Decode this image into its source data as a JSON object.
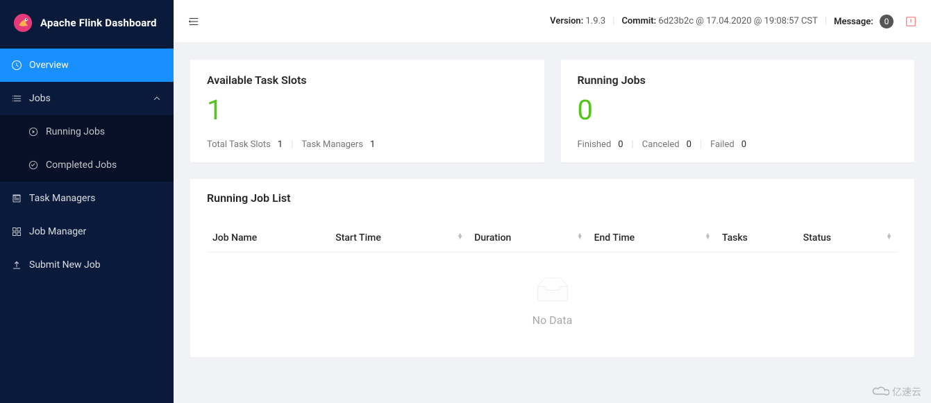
{
  "app": {
    "title": "Apache Flink Dashboard"
  },
  "sidebar": {
    "items": [
      {
        "label": "Overview",
        "icon": "dashboard-icon"
      },
      {
        "label": "Jobs",
        "icon": "jobs-icon",
        "expanded": true,
        "children": [
          {
            "label": "Running Jobs",
            "icon": "play-circle-icon"
          },
          {
            "label": "Completed Jobs",
            "icon": "check-circle-icon"
          }
        ]
      },
      {
        "label": "Task Managers",
        "icon": "schedule-icon"
      },
      {
        "label": "Job Manager",
        "icon": "build-icon"
      },
      {
        "label": "Submit New Job",
        "icon": "upload-icon"
      }
    ]
  },
  "topbar": {
    "version_label": "Version:",
    "version_value": "1.9.3",
    "commit_label": "Commit:",
    "commit_value": "6d23b2c @ 17.04.2020 @ 19:08:57 CST",
    "message_label": "Message:",
    "message_count": "0"
  },
  "cards": {
    "slots": {
      "title": "Available Task Slots",
      "value": "1",
      "total_label": "Total Task Slots",
      "total_value": "1",
      "tm_label": "Task Managers",
      "tm_value": "1"
    },
    "jobs": {
      "title": "Running Jobs",
      "value": "0",
      "finished_label": "Finished",
      "finished_value": "0",
      "canceled_label": "Canceled",
      "canceled_value": "0",
      "failed_label": "Failed",
      "failed_value": "0"
    }
  },
  "joblist": {
    "title": "Running Job List",
    "columns": [
      "Job Name",
      "Start Time",
      "Duration",
      "End Time",
      "Tasks",
      "Status"
    ],
    "sortable": [
      false,
      true,
      true,
      true,
      false,
      true
    ],
    "rows": [],
    "empty_text": "No Data"
  },
  "watermark": "亿速云"
}
